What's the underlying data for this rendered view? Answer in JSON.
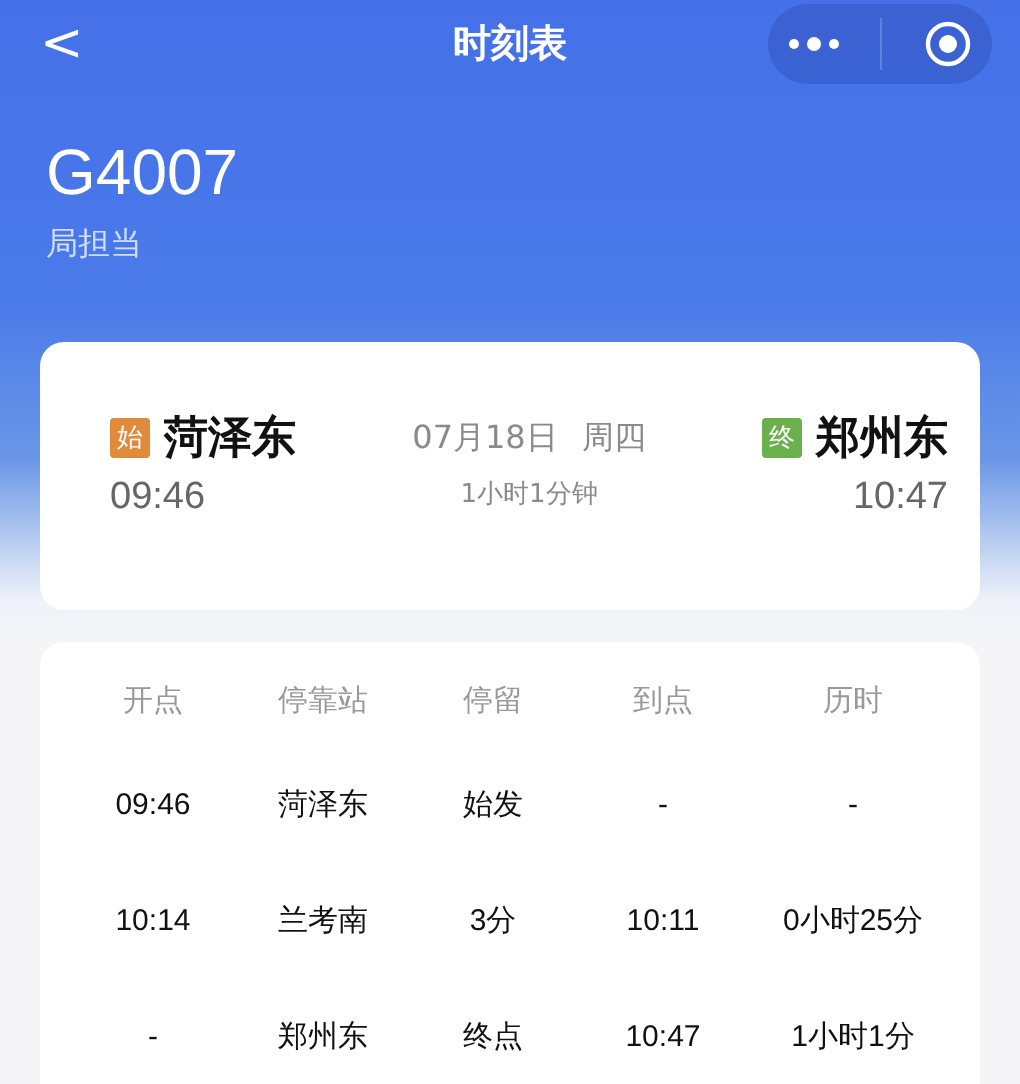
{
  "nav": {
    "back": "<",
    "title": "时刻表"
  },
  "train": {
    "number": "G4007",
    "operator": "局担当"
  },
  "journey": {
    "date": "07月18日",
    "weekday": "周四",
    "duration": "1小时1分钟",
    "stations": [
      {
        "badge": "始",
        "color": "#e08a3c",
        "name": "菏泽东",
        "time": "09:46"
      },
      {
        "badge": "终",
        "color": "#6ab04c",
        "name": "郑州东",
        "time": "10:47"
      }
    ]
  },
  "table": {
    "columns": [
      "开点",
      "停靠站",
      "停留",
      "到点",
      "历时"
    ],
    "rows": [
      [
        "09:46",
        "菏泽东",
        "始发",
        "-",
        "-"
      ],
      [
        "10:14",
        "兰考南",
        "3分",
        "10:11",
        "0小时25分"
      ],
      [
        "-",
        "郑州东",
        "终点",
        "10:47",
        "1小时1分"
      ]
    ]
  }
}
